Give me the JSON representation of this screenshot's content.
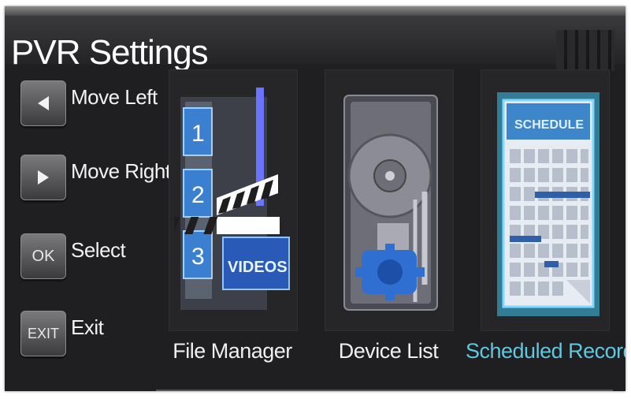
{
  "window": {
    "title": "PVR Settings"
  },
  "hints": [
    {
      "key": "◀",
      "label": "Move Left"
    },
    {
      "key": "▶",
      "label": "Move Right"
    },
    {
      "key": "OK",
      "label": "Select"
    },
    {
      "key": "EXIT",
      "label": "Exit"
    }
  ],
  "menu": [
    {
      "label": "File Manager",
      "icon": "videos-film-icon",
      "selected": false,
      "icon_text": {
        "num1": "1",
        "num2": "2",
        "num3": "3",
        "banner": "VIDEOS"
      }
    },
    {
      "label": "Device List",
      "icon": "hard-drive-icon",
      "selected": false
    },
    {
      "label": "Scheduled Record",
      "icon": "schedule-calendar-icon",
      "selected": true,
      "icon_text": {
        "header": "SCHEDULE"
      }
    }
  ],
  "colors": {
    "background": "#1f1f21",
    "selected_text": "#5fc7e0",
    "text": "#f0f0f0"
  }
}
